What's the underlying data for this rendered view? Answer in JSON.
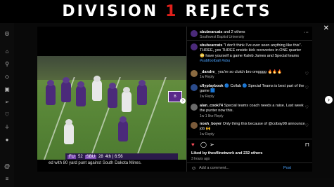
{
  "banner": {
    "part1": "DIVISION",
    "part2": "1",
    "part3": "REJECTS"
  },
  "colors": {
    "accent_red": "#e0201b",
    "link_blue": "#4aa3ff",
    "team_purple": "#4b2a7a"
  },
  "sidebar": {
    "icons": [
      "instagram-icon",
      "home-icon",
      "search-icon",
      "explore-icon",
      "reels-icon",
      "messages-icon",
      "notifications-icon",
      "create-icon",
      "profile-icon",
      "threads-icon",
      "menu-icon"
    ]
  },
  "post": {
    "username": "sbubearcats",
    "coauthor_text": "and 2 others",
    "subtitle": "Southwest Baptist University",
    "caption": "\"I don't think I've ever seen anything like this\". THREE, yes THREE onside kick recoveries in ONE quarter 😳 have yourself a game Kaleb James and Special teams",
    "hashtag": "#subfootball #sbu",
    "video": {
      "scorebug_home": "FU",
      "scorebug_home_score": "52",
      "scorebug_away": "SBU",
      "scorebug_away_score": "28",
      "clock": "4th | 6:56",
      "logo": "B",
      "caption": "ed with 80 yard punt against South Dakota Mines."
    },
    "comments": [
      {
        "user": "_dandre_",
        "text": "you're so clutch bro omgggg 🔥🔥🔥",
        "time": "1w",
        "action": "Reply"
      },
      {
        "user": "cflyplaybook",
        "text": "🔵 Collab 🔵 Special Teams is best part of the game 🟦",
        "time": "1w",
        "action": "Reply"
      },
      {
        "user": "alan_cook74",
        "text": "Special teams coach needs a raise. Last week the punter now this.",
        "time": "1w",
        "likes": "1 like",
        "action": "Reply"
      },
      {
        "user": "noah_boyer",
        "text": "Only thing this because of @cobay98 announce job 🙌",
        "time": "1w",
        "action": "Reply"
      }
    ],
    "liked_by": "Liked by thesflinetwork and 232 others",
    "posted": "3 hours ago",
    "comment_placeholder": "Add a comment...",
    "post_label": "Post"
  }
}
